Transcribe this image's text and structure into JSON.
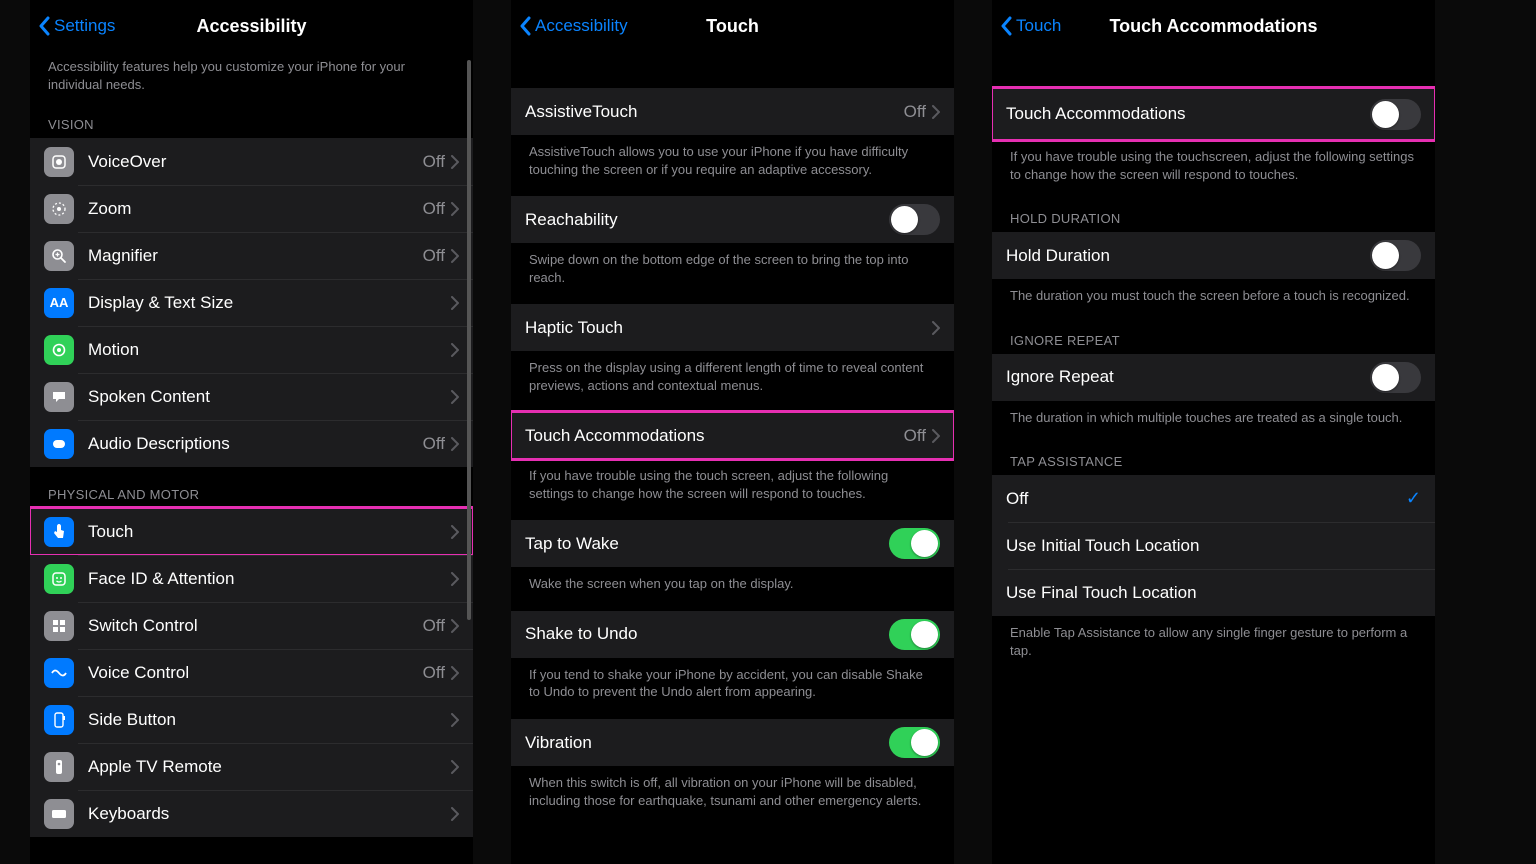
{
  "p1": {
    "back": "Settings",
    "title": "Accessibility",
    "intro": "Accessibility features help you customize your iPhone for your individual needs.",
    "sec_vision": "VISION",
    "rows_vision": [
      {
        "label": "VoiceOver",
        "val": "Off"
      },
      {
        "label": "Zoom",
        "val": "Off"
      },
      {
        "label": "Magnifier",
        "val": "Off"
      },
      {
        "label": "Display & Text Size",
        "val": ""
      },
      {
        "label": "Motion",
        "val": ""
      },
      {
        "label": "Spoken Content",
        "val": ""
      },
      {
        "label": "Audio Descriptions",
        "val": "Off"
      }
    ],
    "sec_motor": "PHYSICAL AND MOTOR",
    "rows_motor": [
      {
        "label": "Touch",
        "val": ""
      },
      {
        "label": "Face ID & Attention",
        "val": ""
      },
      {
        "label": "Switch Control",
        "val": "Off"
      },
      {
        "label": "Voice Control",
        "val": "Off"
      },
      {
        "label": "Side Button",
        "val": ""
      },
      {
        "label": "Apple TV Remote",
        "val": ""
      },
      {
        "label": "Keyboards",
        "val": ""
      }
    ]
  },
  "p2": {
    "back": "Accessibility",
    "title": "Touch",
    "rows": [
      {
        "label": "AssistiveTouch",
        "val": "Off",
        "footer": "AssistiveTouch allows you to use your iPhone if you have difficulty touching the screen or if you require an adaptive accessory."
      },
      {
        "label": "Reachability",
        "toggle": false,
        "footer": "Swipe down on the bottom edge of the screen to bring the top into reach."
      },
      {
        "label": "Haptic Touch",
        "chev": true,
        "footer": "Press on the display using a different length of time to reveal content previews, actions and contextual menus."
      },
      {
        "label": "Touch Accommodations",
        "val": "Off",
        "highlight": true,
        "footer": "If you have trouble using the touch screen, adjust the following settings to change how the screen will respond to touches."
      },
      {
        "label": "Tap to Wake",
        "toggle": true,
        "footer": "Wake the screen when you tap on the display."
      },
      {
        "label": "Shake to Undo",
        "toggle": true,
        "footer": "If you tend to shake your iPhone by accident, you can disable Shake to Undo to prevent the Undo alert from appearing."
      },
      {
        "label": "Vibration",
        "toggle": true,
        "footer": "When this switch is off, all vibration on your iPhone will be disabled, including those for earthquake, tsunami and other emergency alerts."
      }
    ]
  },
  "p3": {
    "back": "Touch",
    "title": "Touch Accommodations",
    "row_main": {
      "label": "Touch Accommodations"
    },
    "footer_main": "If you have trouble using the touchscreen, adjust the following settings to change how the screen will respond to touches.",
    "sec_hold": "HOLD DURATION",
    "row_hold": {
      "label": "Hold Duration"
    },
    "footer_hold": "The duration you must touch the screen before a touch is recognized.",
    "sec_ignore": "IGNORE REPEAT",
    "row_ignore": {
      "label": "Ignore Repeat"
    },
    "footer_ignore": "The duration in which multiple touches are treated as a single touch.",
    "sec_tap": "TAP ASSISTANCE",
    "tap_options": [
      "Off",
      "Use Initial Touch Location",
      "Use Final Touch Location"
    ],
    "footer_tap": "Enable Tap Assistance to allow any single finger gesture to perform a tap."
  }
}
